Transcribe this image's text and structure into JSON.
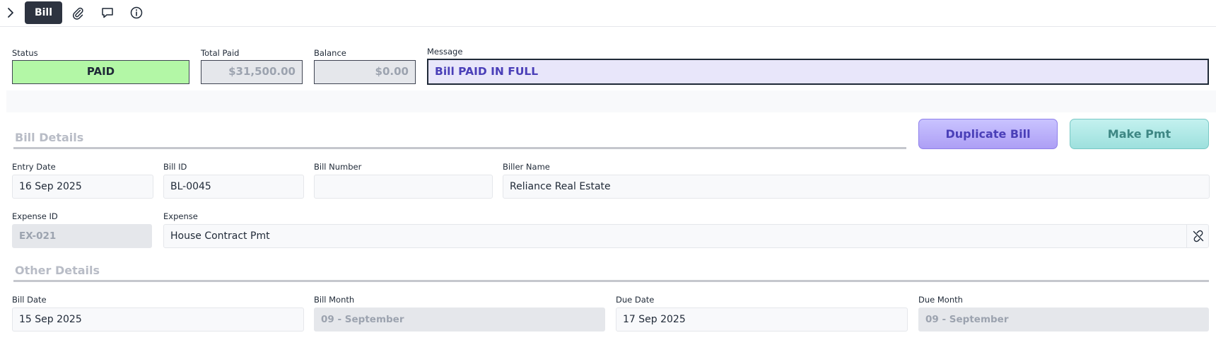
{
  "toolbar": {
    "active_tab": "Bill",
    "icons": [
      "chevron-right-icon",
      "paperclip-icon",
      "comment-icon",
      "info-icon"
    ]
  },
  "summary": {
    "status_label": "Status",
    "status_value": "PAID",
    "status_color": "#b3f7a6",
    "total_paid_label": "Total Paid",
    "total_paid_value": "$31,500.00",
    "balance_label": "Balance",
    "balance_value": "$0.00",
    "message_label": "Message",
    "message_value": "Bill PAID IN FULL",
    "message_color": "#4a3fb8"
  },
  "bill_details": {
    "title": "Bill Details",
    "duplicate_button": "Duplicate Bill",
    "make_pmt_button": "Make Pmt",
    "entry_date_label": "Entry Date",
    "entry_date_value": "16 Sep 2025",
    "bill_id_label": "Bill ID",
    "bill_id_value": "BL-0045",
    "bill_number_label": "Bill Number",
    "bill_number_value": "",
    "biller_name_label": "Biller Name",
    "biller_name_value": "Reliance Real Estate",
    "expense_id_label": "Expense ID",
    "expense_id_value": "EX-021",
    "expense_label": "Expense",
    "expense_value": "House Contract Pmt"
  },
  "other_details": {
    "title": "Other Details",
    "bill_date_label": "Bill Date",
    "bill_date_value": "15 Sep 2025",
    "bill_month_label": "Bill Month",
    "bill_month_value": "09 - September",
    "due_date_label": "Due Date",
    "due_date_value": "17 Sep 2025",
    "due_month_label": "Due Month",
    "due_month_value": "09 - September"
  }
}
